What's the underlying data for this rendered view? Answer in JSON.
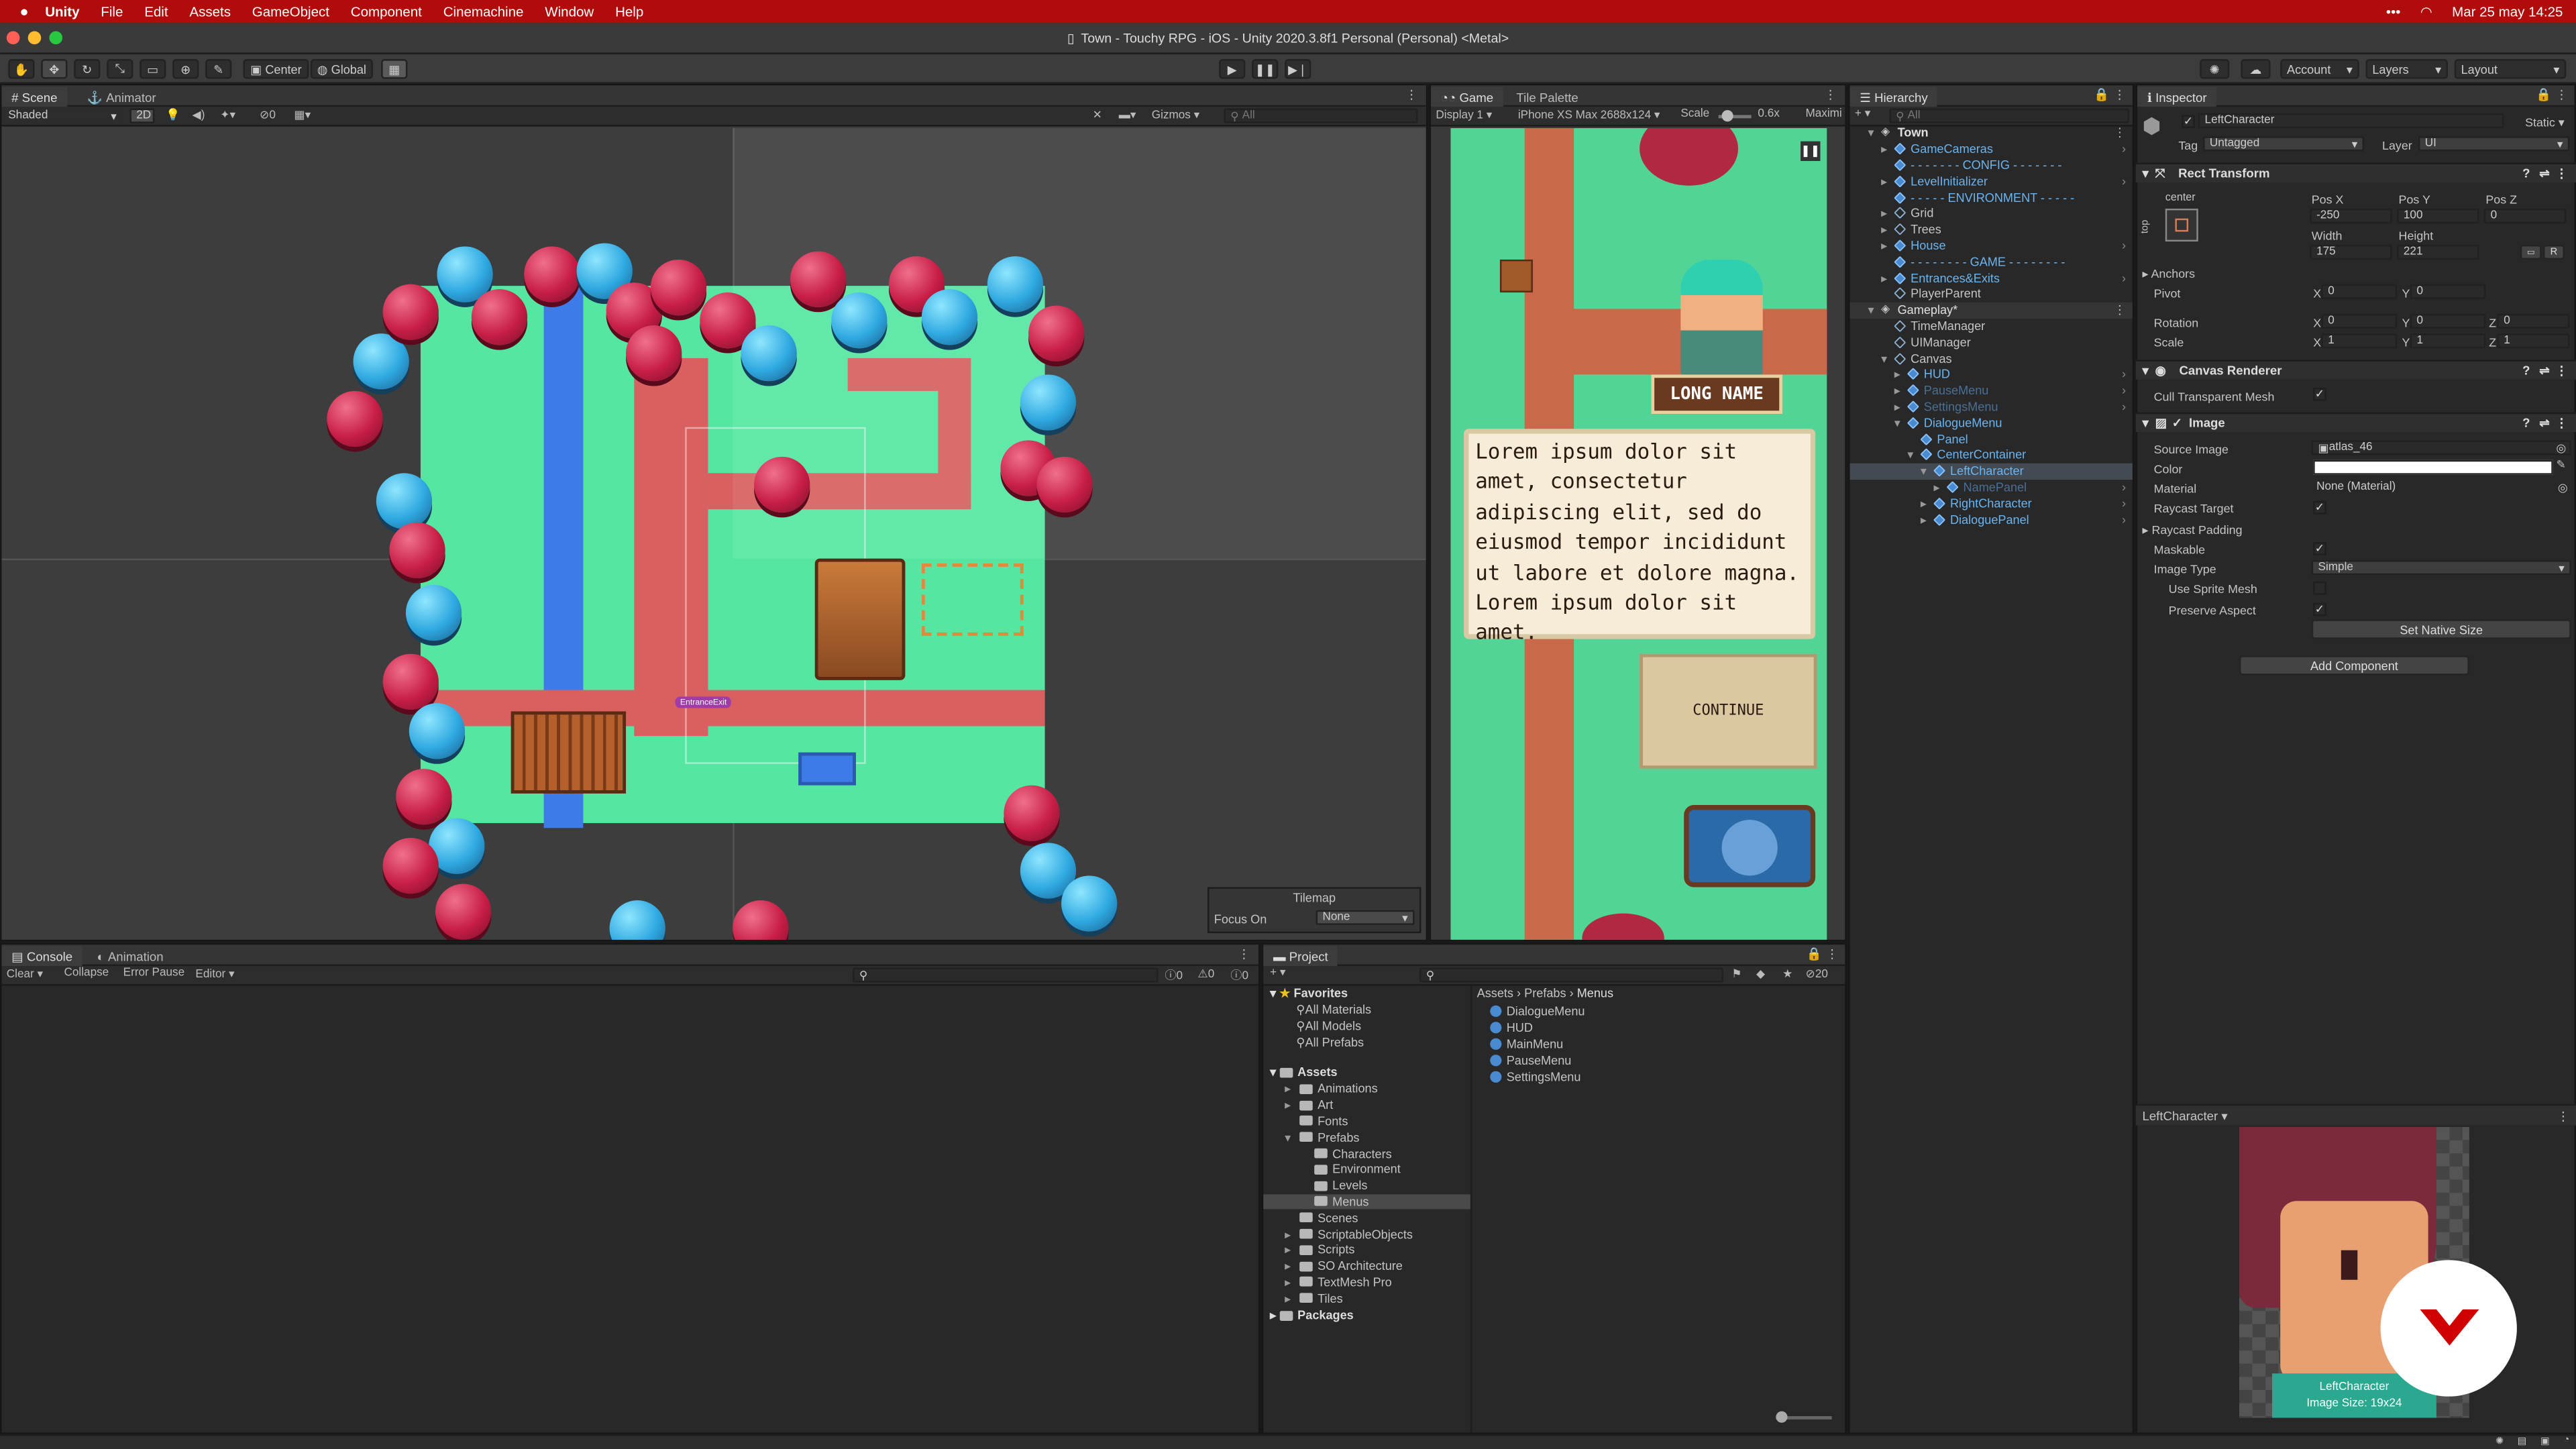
{
  "menubar": {
    "items": [
      "Unity",
      "File",
      "Edit",
      "Assets",
      "GameObject",
      "Component",
      "Cinemachine",
      "Window",
      "Help"
    ],
    "right_more": "•••",
    "datetime": "Mar 25 may  14:25"
  },
  "window_title": "Town - Touchy RPG - iOS - Unity 2020.3.8f1 Personal (Personal) <Metal>",
  "toolbar": {
    "pivot": "Center",
    "space": "Global",
    "account": "Account",
    "layers": "Layers",
    "layout": "Layout"
  },
  "scene": {
    "tabs": [
      "Scene",
      "Animator"
    ],
    "shading": "Shaded",
    "mode2d": "2D",
    "gizmo_count": "0",
    "gizmos": "Gizmos",
    "search_placeholder": "All",
    "entrance_label": "EntranceExit",
    "tilemap": {
      "title": "Tilemap",
      "focus_label": "Focus On",
      "focus_value": "None"
    }
  },
  "game": {
    "tabs": [
      "Game",
      "Tile Palette"
    ],
    "display": "Display 1",
    "device": "iPhone XS Max 2688x124",
    "scale_label": "Scale",
    "scale_value": "0.6x",
    "maximize": "Maximi",
    "name_tag": "LONG NAME",
    "dialogue": "Lorem ipsum dolor sit amet, consectetur adipiscing elit, sed do eiusmod tempor incididunt ut labore et dolore magna. Lorem ipsum dolor sit amet.",
    "continue": "CONTINUE"
  },
  "hierarchy": {
    "tab": "Hierarchy",
    "search": "All",
    "rows": [
      {
        "label": "Town",
        "indent": 0,
        "bold": true,
        "kind": "scene",
        "arrow": "▾",
        "color": "#e0e0e0",
        "sel": false
      },
      {
        "label": "GameCameras",
        "indent": 1,
        "kind": "prefab",
        "arrow": "▸",
        "color": "#6ab4f0",
        "sel": false
      },
      {
        "label": "- - - - - - - CONFIG - - - - - - -",
        "indent": 1,
        "kind": "prefab",
        "arrow": "",
        "color": "#6ab4f0",
        "sel": false
      },
      {
        "label": "LevelInitializer",
        "indent": 1,
        "kind": "prefab",
        "arrow": "▸",
        "color": "#6ab4f0",
        "sel": false
      },
      {
        "label": "- - - - - ENVIRONMENT - - - - -",
        "indent": 1,
        "kind": "prefab",
        "arrow": "",
        "color": "#6ab4f0",
        "sel": false
      },
      {
        "label": "Grid",
        "indent": 1,
        "kind": "go",
        "arrow": "▸",
        "color": "#c4c4c4",
        "sel": false
      },
      {
        "label": "Trees",
        "indent": 1,
        "kind": "go",
        "arrow": "▸",
        "color": "#c4c4c4",
        "sel": false
      },
      {
        "label": "House",
        "indent": 1,
        "kind": "prefab",
        "arrow": "▸",
        "color": "#6ab4f0",
        "sel": false
      },
      {
        "label": "- - - - - - - - GAME - - - - - - - -",
        "indent": 1,
        "kind": "prefab",
        "arrow": "",
        "color": "#6ab4f0",
        "sel": false
      },
      {
        "label": "Entrances&Exits",
        "indent": 1,
        "kind": "prefab",
        "arrow": "▸",
        "color": "#6ab4f0",
        "sel": false
      },
      {
        "label": "PlayerParent",
        "indent": 1,
        "kind": "go",
        "arrow": "",
        "color": "#c4c4c4",
        "sel": false
      },
      {
        "label": "Gameplay*",
        "indent": 0,
        "kind": "scene",
        "arrow": "▾",
        "color": "#e0e0e0",
        "sel": false,
        "band": true
      },
      {
        "label": "TimeManager",
        "indent": 1,
        "kind": "go",
        "arrow": "",
        "color": "#c4c4c4",
        "sel": false
      },
      {
        "label": "UIManager",
        "indent": 1,
        "kind": "go",
        "arrow": "",
        "color": "#c4c4c4",
        "sel": false
      },
      {
        "label": "Canvas",
        "indent": 1,
        "kind": "go",
        "arrow": "▾",
        "color": "#c4c4c4",
        "sel": false
      },
      {
        "label": "HUD",
        "indent": 2,
        "kind": "prefab",
        "arrow": "▸",
        "color": "#6ab4f0",
        "sel": false
      },
      {
        "label": "PauseMenu",
        "indent": 2,
        "kind": "prefab",
        "arrow": "▸",
        "color": "#4a6f94",
        "sel": false
      },
      {
        "label": "SettingsMenu",
        "indent": 2,
        "kind": "prefab",
        "arrow": "▸",
        "color": "#4a6f94",
        "sel": false
      },
      {
        "label": "DialogueMenu",
        "indent": 2,
        "kind": "prefab",
        "arrow": "▾",
        "color": "#6ab4f0",
        "sel": false
      },
      {
        "label": "Panel",
        "indent": 3,
        "kind": "prefab",
        "arrow": "",
        "color": "#6ab4f0",
        "sel": false
      },
      {
        "label": "CenterContainer",
        "indent": 3,
        "kind": "prefab",
        "arrow": "▾",
        "color": "#6ab4f0",
        "sel": false
      },
      {
        "label": "LeftCharacter",
        "indent": 4,
        "kind": "prefab",
        "arrow": "▾",
        "color": "#6ab4f0",
        "sel": true
      },
      {
        "label": "NamePanel",
        "indent": 5,
        "kind": "prefab",
        "arrow": "▸",
        "color": "#4a6f94",
        "sel": false
      },
      {
        "label": "RightCharacter",
        "indent": 4,
        "kind": "prefab",
        "arrow": "▸",
        "color": "#6ab4f0",
        "sel": false
      },
      {
        "label": "DialoguePanel",
        "indent": 4,
        "kind": "prefab",
        "arrow": "▸",
        "color": "#6ab4f0",
        "sel": false
      }
    ]
  },
  "inspector": {
    "tab": "Inspector",
    "object_name": "LeftCharacter",
    "static": "Static",
    "tag_label": "Tag",
    "tag_value": "Untagged",
    "layer_label": "Layer",
    "layer_value": "UI",
    "rect_transform": {
      "title": "Rect Transform",
      "anchor_preset": "center",
      "side_label": "top",
      "posx_label": "Pos X",
      "posy_label": "Pos Y",
      "posz_label": "Pos Z",
      "posx": "-250",
      "posy": "100",
      "posz": "0",
      "width_label": "Width",
      "height_label": "Height",
      "width": "175",
      "height": "221",
      "anchors": "Anchors",
      "pivot": "Pivot",
      "pivot_x": "0",
      "pivot_y": "0",
      "rotation": "Rotation",
      "rot_x": "0",
      "rot_y": "0",
      "rot_z": "0",
      "scale": "Scale",
      "scale_x": "1",
      "scale_y": "1",
      "scale_z": "1",
      "x": "X",
      "y": "Y",
      "z": "Z",
      "r_btn": "R"
    },
    "canvas_renderer": {
      "title": "Canvas Renderer",
      "cull_label": "Cull Transparent Mesh"
    },
    "image": {
      "title": "Image",
      "source_label": "Source Image",
      "source_value": "atlas_46",
      "color_label": "Color",
      "material_label": "Material",
      "material_value": "None (Material)",
      "raycast_target": "Raycast Target",
      "raycast_padding": "Raycast Padding",
      "maskable": "Maskable",
      "image_type_label": "Image Type",
      "image_type_value": "Simple",
      "use_sprite_mesh": "Use Sprite Mesh",
      "preserve_aspect": "Preserve Aspect",
      "native_size": "Set Native Size"
    },
    "add_component": "Add Component",
    "preview_title": "LeftCharacter",
    "preview_name": "LeftCharacter",
    "preview_size": "Image Size: 19x24"
  },
  "console": {
    "tabs": [
      "Console",
      "Animation"
    ],
    "clear": "Clear",
    "collapse": "Collapse",
    "error_pause": "Error Pause",
    "editor": "Editor",
    "counts": [
      "0",
      "0",
      "0"
    ]
  },
  "project": {
    "tab": "Project",
    "favorites": {
      "label": "Favorites",
      "items": [
        "All Materials",
        "All Models",
        "All Prefabs"
      ]
    },
    "assets_label": "Assets",
    "tree": [
      {
        "label": "Animations",
        "indent": 1,
        "arrow": "▸"
      },
      {
        "label": "Art",
        "indent": 1,
        "arrow": "▸"
      },
      {
        "label": "Fonts",
        "indent": 1,
        "arrow": ""
      },
      {
        "label": "Prefabs",
        "indent": 1,
        "arrow": "▾"
      },
      {
        "label": "Characters",
        "indent": 2,
        "arrow": ""
      },
      {
        "label": "Environment",
        "indent": 2,
        "arrow": ""
      },
      {
        "label": "Levels",
        "indent": 2,
        "arrow": ""
      },
      {
        "label": "Menus",
        "indent": 2,
        "arrow": "",
        "sel": true
      },
      {
        "label": "Scenes",
        "indent": 1,
        "arrow": ""
      },
      {
        "label": "ScriptableObjects",
        "indent": 1,
        "arrow": "▸"
      },
      {
        "label": "Scripts",
        "indent": 1,
        "arrow": "▸"
      },
      {
        "label": "SO Architecture",
        "indent": 1,
        "arrow": "▸"
      },
      {
        "label": "TextMesh Pro",
        "indent": 1,
        "arrow": "▸"
      },
      {
        "label": "Tiles",
        "indent": 1,
        "arrow": "▸"
      }
    ],
    "packages_label": "Packages",
    "breadcrumb": [
      "Assets",
      "Prefabs",
      "Menus"
    ],
    "files": [
      "DialogueMenu",
      "HUD",
      "MainMenu",
      "PauseMenu",
      "SettingsMenu"
    ],
    "hidden_count": "20"
  }
}
